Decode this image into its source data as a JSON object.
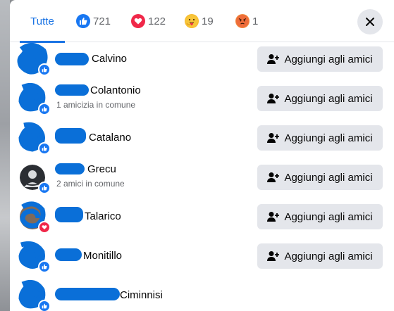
{
  "tabs": {
    "all_label": "Tutte",
    "like_count": "721",
    "love_count": "122",
    "care_count": "19",
    "angry_count": "1"
  },
  "icons": {
    "like": "thumbs-up-icon",
    "love": "heart-icon",
    "care": "care-hug-emoji-icon",
    "angry": "angry-face-icon",
    "close": "close-icon",
    "add_friend": "add-friend-icon"
  },
  "colors": {
    "accent": "#1b74e4",
    "like_badge": "#1877f2",
    "love_badge": "#f02849",
    "button_bg": "#e4e6eb"
  },
  "people": [
    {
      "name_visible": "Calvino",
      "mutual": "",
      "badge": "like",
      "button": "Aggiungi agli amici"
    },
    {
      "name_visible": "Colantonio",
      "mutual": "1 amicizia in comune",
      "badge": "like",
      "button": "Aggiungi agli amici"
    },
    {
      "name_visible": "Catalano",
      "mutual": "",
      "badge": "like",
      "button": "Aggiungi agli amici"
    },
    {
      "name_visible": "Grecu",
      "mutual": "2 amici in comune",
      "badge": "like",
      "button": "Aggiungi agli amici"
    },
    {
      "name_visible": "Talarico",
      "mutual": "",
      "badge": "love",
      "button": "Aggiungi agli amici"
    },
    {
      "name_visible": "Monitillo",
      "mutual": "",
      "badge": "like",
      "button": "Aggiungi agli amici"
    },
    {
      "name_visible": "Ciminnisi",
      "mutual": "",
      "badge": "like",
      "button": ""
    }
  ]
}
